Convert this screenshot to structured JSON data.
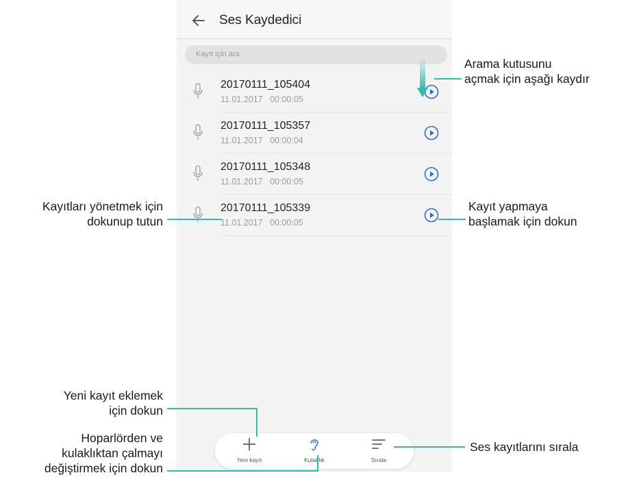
{
  "app": {
    "title": "Ses Kaydedici",
    "search_placeholder": "Kayıt için ara"
  },
  "recordings": [
    {
      "name": "20170111_105404",
      "date": "11.01.2017",
      "duration": "00:00:05"
    },
    {
      "name": "20170111_105357",
      "date": "11.01.2017",
      "duration": "00:00:04"
    },
    {
      "name": "20170111_105348",
      "date": "11.01.2017",
      "duration": "00:00:05"
    },
    {
      "name": "20170111_105339",
      "date": "11.01.2017",
      "duration": "00:00:05"
    }
  ],
  "toolbar": {
    "new_label": "Yeni kayıt",
    "earpiece_label": "Kulaklık",
    "sort_label": "Sırala"
  },
  "annotations": {
    "pull_down": [
      "Arama kutusunu",
      "açmak için aşağı kaydır"
    ],
    "manage": [
      "Kayıtları yönetmek için",
      "dokunup tutun"
    ],
    "play": [
      "Kayıt yapmaya",
      "başlamak için dokun"
    ],
    "add": [
      "Yeni kayıt eklemek",
      "için dokun"
    ],
    "toggle": [
      "Hoparlörden ve",
      "kulaklıktan çalmayı",
      "değiştirmek için dokun"
    ],
    "sort": [
      "Ses kayıtlarını sırala"
    ]
  },
  "colors": {
    "accent": "#36b7b3",
    "play_icon": "#2f6fbf",
    "icon_gray": "#9a9a9a"
  },
  "icons": {
    "back": "back-arrow-icon",
    "mic": "microphone-icon",
    "play": "play-circle-icon",
    "add": "plus-icon",
    "ear": "ear-icon",
    "sort": "sort-icon",
    "pull": "pull-down-arrow-icon"
  }
}
